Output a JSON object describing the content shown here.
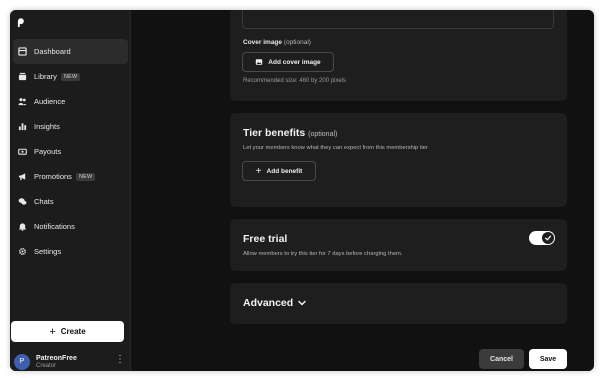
{
  "sidebar": {
    "items": [
      {
        "label": "Dashboard",
        "icon": "dashboard-icon",
        "active": true
      },
      {
        "label": "Library",
        "icon": "library-icon",
        "badge": "NEW"
      },
      {
        "label": "Audience",
        "icon": "audience-icon"
      },
      {
        "label": "Insights",
        "icon": "insights-icon"
      },
      {
        "label": "Payouts",
        "icon": "payouts-icon"
      },
      {
        "label": "Promotions",
        "icon": "promotions-icon",
        "badge": "NEW"
      },
      {
        "label": "Chats",
        "icon": "chats-icon"
      },
      {
        "label": "Notifications",
        "icon": "bell-icon"
      },
      {
        "label": "Settings",
        "icon": "gear-icon"
      }
    ],
    "create_label": "Create",
    "profile": {
      "initial": "P",
      "name": "PatreonFree",
      "role": "Creator"
    }
  },
  "cover": {
    "label": "Cover image",
    "optional": "(optional)",
    "button": "Add cover image",
    "hint": "Recommended size: 460 by 200 pixels"
  },
  "benefits": {
    "title": "Tier benefits",
    "optional": "(optional)",
    "subtitle": "Let your members know what they can expect from this membership tier",
    "button": "Add benefit"
  },
  "trial": {
    "title": "Free trial",
    "subtitle": "Allow members to try this tier for 7 days before charging them.",
    "enabled": true
  },
  "advanced": {
    "title": "Advanced"
  },
  "footer": {
    "cancel": "Cancel",
    "save": "Save"
  },
  "colors": {
    "background": "#111111",
    "sidebar": "#1c1c1c",
    "card": "#1e1e1e",
    "avatar": "#3f5fae"
  }
}
